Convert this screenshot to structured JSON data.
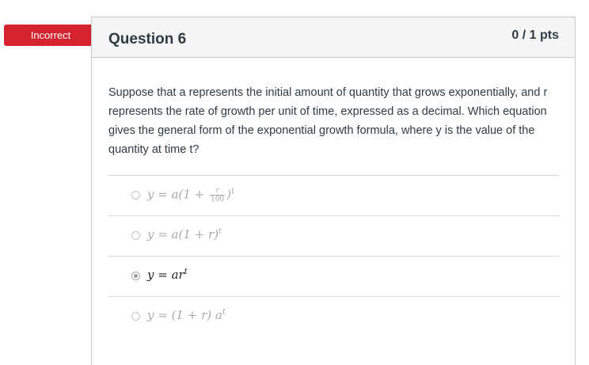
{
  "status": {
    "label": "Incorrect",
    "color": "#d5222f"
  },
  "question": {
    "title": "Question 6",
    "points": "0 / 1 pts",
    "text": "Suppose that a represents the initial amount of quantity that grows exponentially, and r represents the rate of growth per unit of time, expressed as a decimal. Which equation gives the general form of the exponential growth formula, where y is the value of the quantity at time t?"
  },
  "answers": [
    {
      "lhs": "y = a(1 + ",
      "num": "r",
      "den": "100",
      "rhs": ")",
      "exp": "t",
      "selected": false
    },
    {
      "lhs": "y = a(1 + r)",
      "exp": "t",
      "selected": false
    },
    {
      "lhs": "y = ar",
      "exp": "t",
      "selected": true
    },
    {
      "lhs": "y = (1 + r) a",
      "exp": "t",
      "selected": false
    }
  ]
}
